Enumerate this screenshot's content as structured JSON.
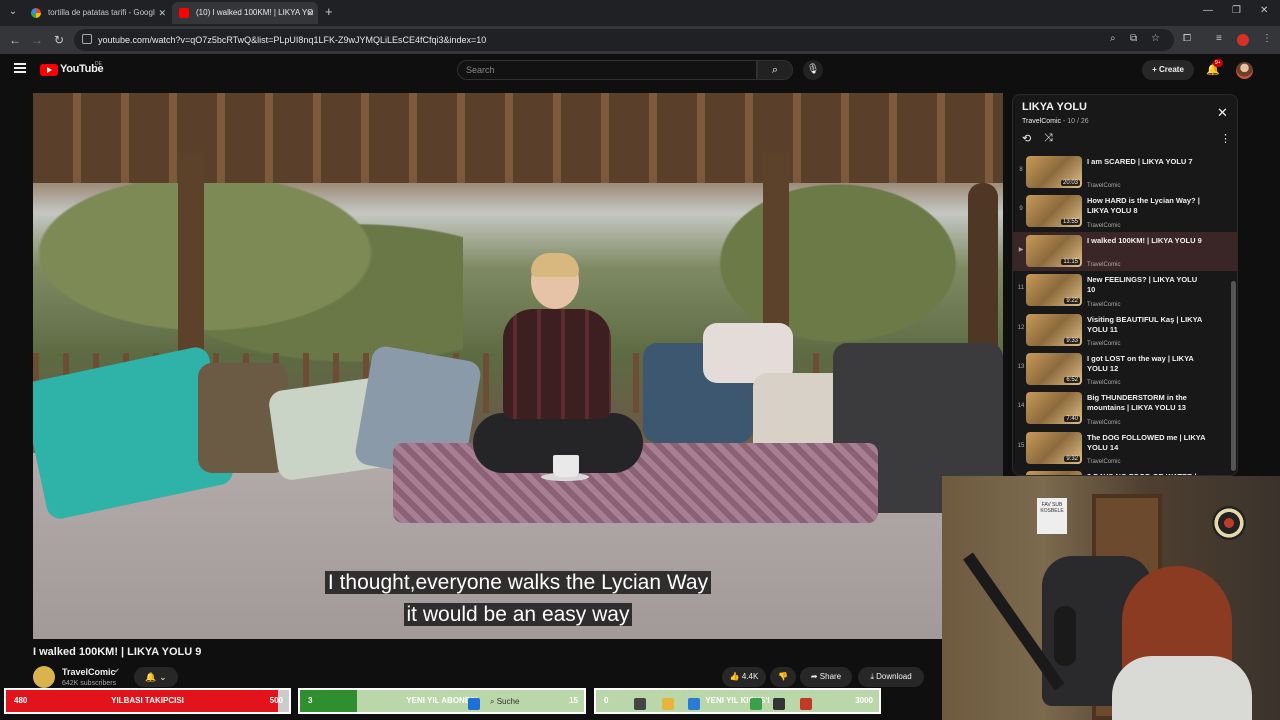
{
  "browser": {
    "tabs": [
      {
        "title": "tortilla de patatas tarifi - Googl",
        "active": false
      },
      {
        "title": "(10) I walked 100KM! | LIKYA YO",
        "active": true
      }
    ],
    "url": "youtube.com/watch?v=qO7z5bcRTwQ&list=PLpUI8nq1LFK-Z9wJYMQLiLEsCE4fCfqi3&index=10"
  },
  "yt": {
    "logo_text": "YouTube",
    "logo_region": "DE",
    "search_placeholder": "Search",
    "create_label": "Create",
    "notif_badge": "9+"
  },
  "video": {
    "subtitle_line1": "I thought,everyone walks the Lycian Way",
    "subtitle_line2": "it would be an easy way",
    "title": "I walked 100KM! | LIKYA YOLU 9",
    "channel": "TravelComic",
    "subscribers": "642K subscribers",
    "likes": "4.4K",
    "share_label": "Share",
    "download_label": "Download"
  },
  "playlist": {
    "title": "LIKYA YOLU",
    "channel": "TravelComic",
    "position": "10 / 26",
    "items": [
      {
        "index": "8",
        "title": "I am SCARED | LIKYA YOLU 7",
        "channel": "TravelComic",
        "duration": "20:03",
        "current": false
      },
      {
        "index": "9",
        "title": "How HARD is the Lycian Way? | LIKYA YOLU 8",
        "channel": "TravelComic",
        "duration": "13:55",
        "current": false
      },
      {
        "index": "▶",
        "title": "I walked 100KM! | LIKYA YOLU 9",
        "channel": "TravelComic",
        "duration": "11:15",
        "current": true
      },
      {
        "index": "11",
        "title": "New FEELINGS? | LIKYA YOLU 10",
        "channel": "TravelComic",
        "duration": "9:22",
        "current": false
      },
      {
        "index": "12",
        "title": "Visiting BEAUTIFUL Kaş | LIKYA YOLU 11",
        "channel": "TravelComic",
        "duration": "9:33",
        "current": false
      },
      {
        "index": "13",
        "title": "I got LOST on the way | LIKYA YOLU 12",
        "channel": "TravelComic",
        "duration": "6:52",
        "current": false
      },
      {
        "index": "14",
        "title": "Big THUNDERSTORM in the mountains | LIKYA YOLU 13",
        "channel": "TravelComic",
        "duration": "7:40",
        "current": false
      },
      {
        "index": "15",
        "title": "The DOG FOLLOWED me | LIKYA YOLU 14",
        "channel": "TravelComic",
        "duration": "9:32",
        "current": false
      },
      {
        "index": "",
        "title": "3 DAYS NO FOOD OR WATER |",
        "channel": "",
        "duration": "",
        "current": false
      }
    ]
  },
  "overlay": {
    "shelf_text": "FAV SUB KOSBELE",
    "goals": [
      {
        "current": "480",
        "label": "YILBASI TAKIPCISI",
        "target": "500",
        "progress": 0.96,
        "color": "#e3131b"
      },
      {
        "current": "3",
        "label": "YENI YIL ABONESI",
        "target": "15",
        "progress": 0.2,
        "color": "#2f8f2f"
      },
      {
        "current": "0",
        "label": "YENI YIL KICKS'I",
        "target": "3000",
        "progress": 0.0,
        "color": "#3cc43c"
      }
    ],
    "taskbar_search": "Suche"
  },
  "colors": {
    "yt_red": "#ff0000",
    "bg": "#0f0f0f",
    "panel": "#181818"
  }
}
